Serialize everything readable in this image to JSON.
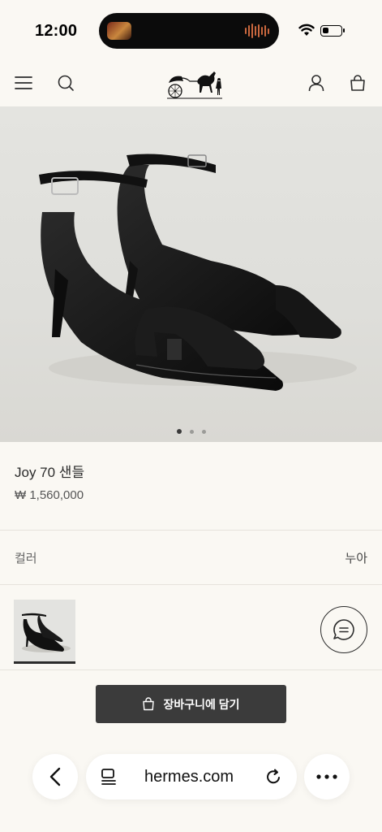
{
  "status_bar": {
    "time": "12:00"
  },
  "product": {
    "name": "Joy 70 샌들",
    "price": "₩ 1,560,000",
    "color_label": "컬러",
    "color_value": "누아"
  },
  "carousel": {
    "total": 3,
    "active": 1
  },
  "cart": {
    "label": "장바구니에 담기"
  },
  "browser": {
    "url": "hermes.com"
  },
  "colors": {
    "accent": "#3b3b3b",
    "background": "#faf8f3"
  }
}
